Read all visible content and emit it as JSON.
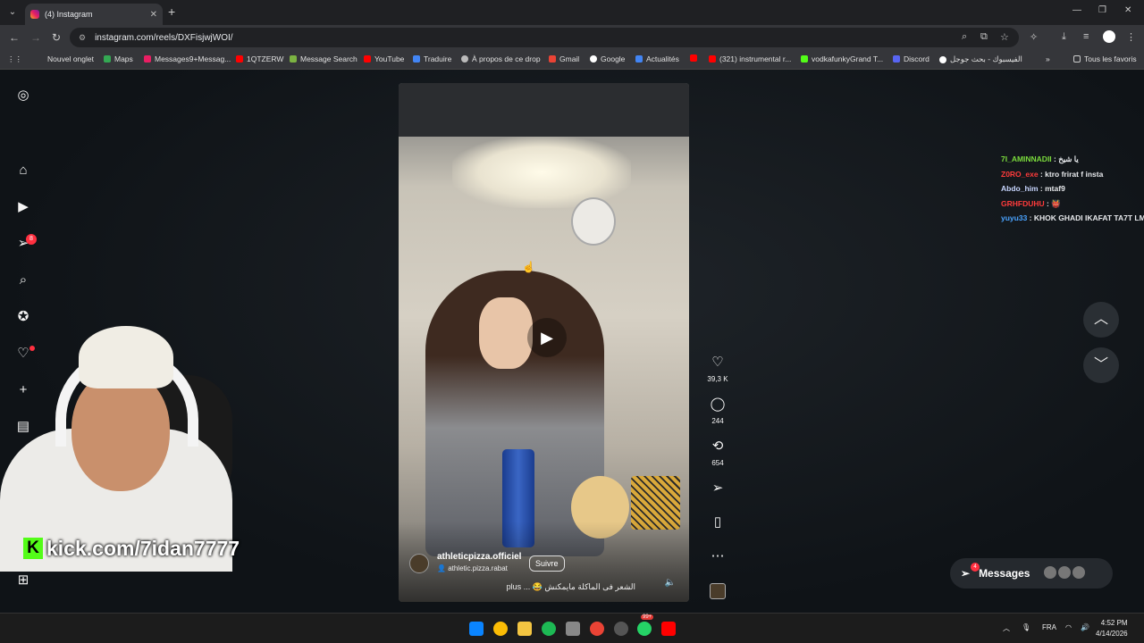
{
  "browser": {
    "tab_title": "(4) Instagram",
    "url": "instagram.com/reels/DXFisjwjWOI/",
    "new_tab": "+",
    "bookmarks": [
      "Nouvel onglet",
      "Maps",
      "Messages9+Messag...",
      "1QTZERW",
      "Message Search",
      "YouTube",
      "Traduire",
      "À propos de ce drop",
      "Gmail",
      "Google",
      "Actualités",
      "(321) instrumental r...",
      "vodkafunkyGrand T...",
      "Discord",
      "الفيسبوك - بحث جوجل"
    ],
    "all_bookmarks": "Tous les favoris"
  },
  "sidebar": {
    "notification_badge": "8"
  },
  "reel": {
    "username": "athleticpizza.officiel",
    "sub_account": "athletic.pizza.rabat",
    "follow_label": "Suivre",
    "caption": "الشعر فى الماكلة مايمكنش 😂 ... plus",
    "likes": "39,3 K",
    "comments": "244",
    "reposts": "654"
  },
  "chat": [
    {
      "user": "7I_AMINNADII",
      "msg": "يا شيخ"
    },
    {
      "user": "Z0RO_exe",
      "msg": "ktro frirat f insta"
    },
    {
      "user": "Abdo_him",
      "msg": "mtaf9"
    },
    {
      "user": "GRHFDUHU",
      "msg": "👹"
    },
    {
      "user": "yuyu33",
      "msg": "KHOK GHADI IKAFAT TA7T LM"
    }
  ],
  "messages": {
    "label": "Messages",
    "badge": "4"
  },
  "stream": {
    "overlay": "kick.com/7idan7777"
  },
  "taskbar": {
    "lang": "FRA",
    "time": "4:52 PM",
    "date": "4/14/2026",
    "whatsapp_badge": "99+"
  }
}
